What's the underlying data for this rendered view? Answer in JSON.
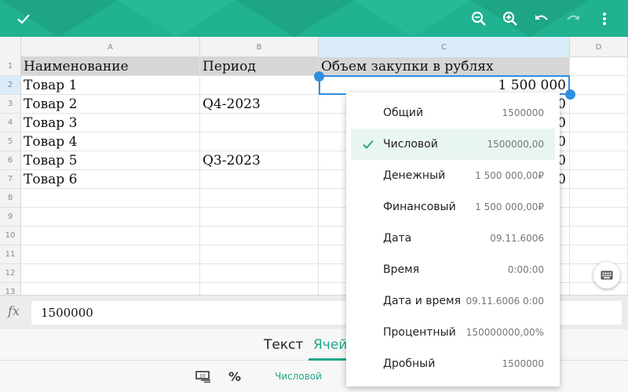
{
  "toolbar_top": {
    "accept_icon": "check-icon",
    "zoom_out_icon": "zoom-out-icon",
    "zoom_in_icon": "zoom-in-icon",
    "undo_icon": "undo-icon",
    "redo_icon": "redo-icon",
    "more_icon": "more-vert-icon"
  },
  "colors": {
    "accent": "#20b291",
    "selection": "#2f8ee0",
    "header_fill": "#d6d6d6"
  },
  "sheet": {
    "columns": [
      "A",
      "B",
      "C",
      "D"
    ],
    "rows": [
      "1",
      "2",
      "3",
      "4",
      "5",
      "6",
      "7",
      "8",
      "9",
      "10",
      "11",
      "12",
      "13"
    ],
    "selected_column": "C",
    "selected_row": "2",
    "cells": {
      "A1": "Наименование",
      "B1": "Период",
      "C1": "Объем закупки в рублях",
      "A2": "Товар 1",
      "C2": "1 500 000",
      "A3": "Товар 2",
      "B3": "Q4-2023",
      "C3": "0",
      "A4": "Товар 3",
      "C4": "0",
      "A5": "Товар 4",
      "C5": "0",
      "A6": "Товар 5",
      "B6": "Q3-2023",
      "C6": "0",
      "A7": "Товар 6",
      "C7": "0"
    }
  },
  "formula_bar": {
    "fx_label": "fx",
    "value": "1500000"
  },
  "tabs": {
    "text": "Текст",
    "cell": "Ячей"
  },
  "bottom_toolbar": {
    "format_label": "Числовой",
    "percent_icon": "percent-icon",
    "number_format_icon": "number-format-icon"
  },
  "format_menu": {
    "selected": "Числовой",
    "items": [
      {
        "name": "Общий",
        "example": "1500000"
      },
      {
        "name": "Числовой",
        "example": "1500000,00"
      },
      {
        "name": "Денежный",
        "example": "1 500 000,00₽"
      },
      {
        "name": "Финансовый",
        "example": "1 500 000,00₽"
      },
      {
        "name": "Дата",
        "example": "09.11.6006"
      },
      {
        "name": "Время",
        "example": "0:00:00"
      },
      {
        "name": "Дата и время",
        "example": "09.11.6006 0:00"
      },
      {
        "name": "Процентный",
        "example": "150000000,00%"
      },
      {
        "name": "Дробный",
        "example": "1500000"
      }
    ]
  },
  "keyboard_button_icon": "keyboard-icon"
}
